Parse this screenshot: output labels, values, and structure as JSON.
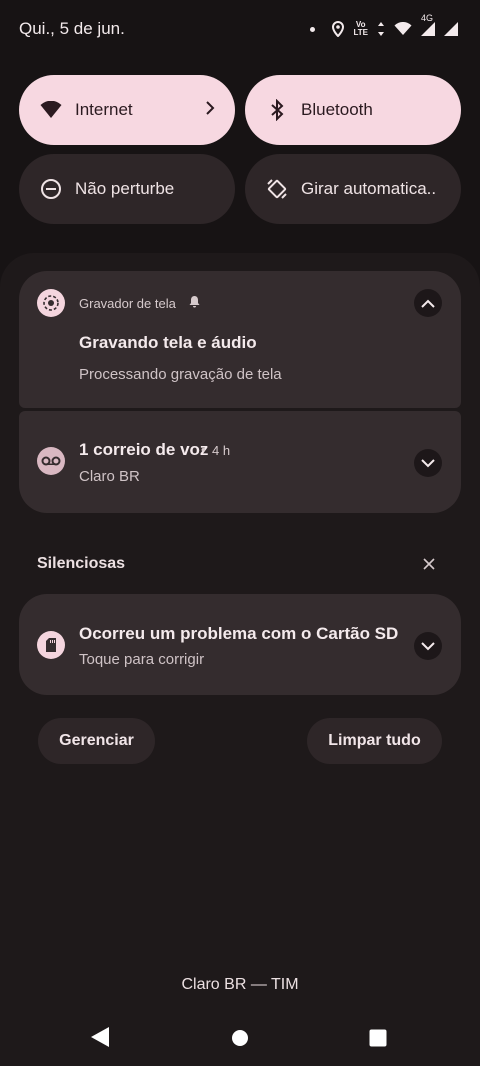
{
  "status_bar": {
    "date": "Qui., 5 de jun.",
    "volte_top": "Vo",
    "volte_bottom": "LTE",
    "network_type": "4G",
    "icons": [
      "dot",
      "location-icon",
      "volte-icon",
      "data-arrows-icon",
      "wifi-icon",
      "signal-icon",
      "signal-icon"
    ]
  },
  "quick_tiles": [
    {
      "label": "Internet",
      "icon": "wifi-icon",
      "state": "on",
      "has_chevron": true
    },
    {
      "label": "Bluetooth",
      "icon": "bluetooth-icon",
      "state": "on"
    },
    {
      "label": "Não perturbe",
      "icon": "do-not-disturb-icon",
      "state": "off"
    },
    {
      "label": "Girar automatica..",
      "icon": "auto-rotate-icon",
      "state": "off"
    }
  ],
  "notifications": [
    {
      "app": "Gravador de tela",
      "title": "Gravando tela e áudio",
      "body": "Processando gravação de tela",
      "icon": "screen-recorder-icon",
      "expanded": true
    },
    {
      "title": "1 correio de voz",
      "time": "4 h",
      "body": "Claro BR",
      "icon": "voicemail-icon",
      "expanded": false
    }
  ],
  "silent_section": {
    "header": "Silenciosas",
    "notification": {
      "title": "Ocorreu um problema com o Cartão SD",
      "body": "Toque para corrigir",
      "icon": "sd-card-icon"
    }
  },
  "actions": {
    "manage": "Gerenciar",
    "clear_all": "Limpar tudo"
  },
  "carrier_label": "Claro BR — TIM",
  "colors": {
    "background": "#171314",
    "shade": "#1e191a",
    "card": "#342c2e",
    "tile_active": "#f7d8e1",
    "tile_inactive": "#2e2628"
  }
}
